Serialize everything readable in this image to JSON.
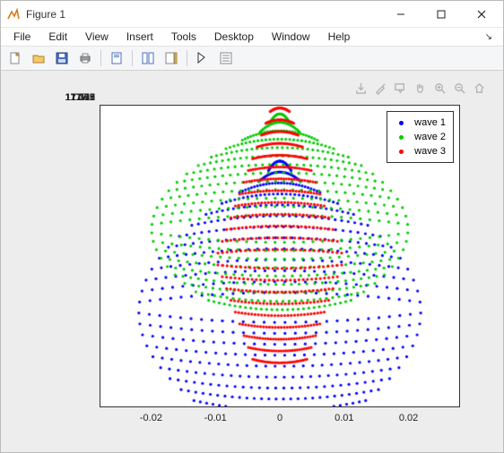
{
  "window": {
    "title": "Figure 1"
  },
  "menu": {
    "items": [
      "File",
      "Edit",
      "View",
      "Insert",
      "Tools",
      "Desktop",
      "Window",
      "Help"
    ]
  },
  "toolbar_icons": [
    "new-figure-icon",
    "open-icon",
    "save-icon",
    "print-icon",
    "sep",
    "print-preview-icon",
    "sep",
    "link-icon",
    "colorbar-icon",
    "sep",
    "pointer-icon",
    "inspect-icon"
  ],
  "legend": {
    "items": [
      {
        "label": "wave 1",
        "color": "#0000ff"
      },
      {
        "label": "wave 2",
        "color": "#00cc00"
      },
      {
        "label": "wave 3",
        "color": "#ff0000"
      }
    ]
  },
  "chart_data": {
    "type": "scatter",
    "title": "",
    "xlabel": "",
    "ylabel": "",
    "xlim": [
      -0.028,
      0.028
    ],
    "ylim": [
      17.067,
      17.118
    ],
    "xticks": [
      -0.02,
      -0.01,
      0,
      0.01,
      0.02
    ],
    "yticks": [
      17.07,
      17.075,
      17.08,
      17.085,
      17.09,
      17.095,
      17.1,
      17.105,
      17.11,
      17.115
    ],
    "series": [
      {
        "name": "wave 1",
        "color": "#0000ff",
        "marker_size": 2,
        "pattern": "fan",
        "center_y": 17.083,
        "y_range": [
          17.068,
          17.107
        ],
        "x_half_width_max": 0.022
      },
      {
        "name": "wave 2",
        "color": "#00cc00",
        "marker_size": 2,
        "pattern": "fan",
        "center_y": 17.097,
        "y_range": [
          17.085,
          17.115
        ],
        "x_half_width_max": 0.02
      },
      {
        "name": "wave 3",
        "color": "#ff0000",
        "marker_size": 2,
        "pattern": "diamond",
        "center_y": 17.092,
        "y_range": [
          17.075,
          17.117
        ],
        "x_half_width_max": 0.01
      }
    ]
  }
}
